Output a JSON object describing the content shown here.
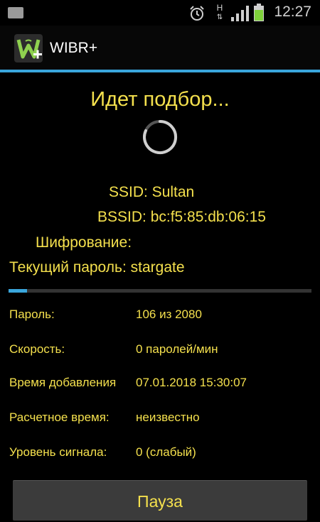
{
  "status_bar": {
    "time": "12:27",
    "network_type": "H",
    "icons": [
      "notification-icon",
      "alarm-icon",
      "network-type-icon",
      "signal-icon",
      "battery-icon"
    ],
    "colors": {
      "text": "#cfcfcf",
      "battery": "#7fd13b"
    }
  },
  "app": {
    "title": "WIBR+",
    "logo_letter": "W",
    "accent_color": "#3aa6dc",
    "text_color": "#f4e04d"
  },
  "main": {
    "heading": "Идет подбор...",
    "ssid": "SSID: Sultan",
    "bssid": "BSSID: bc:f5:85:db:06:15",
    "encryption": "Шифрование:",
    "current_password": "Текущий пароль: stargate",
    "progress_fraction": 0.06
  },
  "stats": [
    {
      "label": "Пароль:",
      "value": "106 из 2080"
    },
    {
      "label": "Скорость:",
      "value": "0 паролей/мин"
    },
    {
      "label": "Время добавления",
      "value": "07.01.2018 15:30:07"
    },
    {
      "label": "Расчетное время:",
      "value": "неизвестно"
    },
    {
      "label": "Уровень сигнала:",
      "value": "0 (слабый)"
    }
  ],
  "actions": {
    "pause_label": "Пауза"
  }
}
